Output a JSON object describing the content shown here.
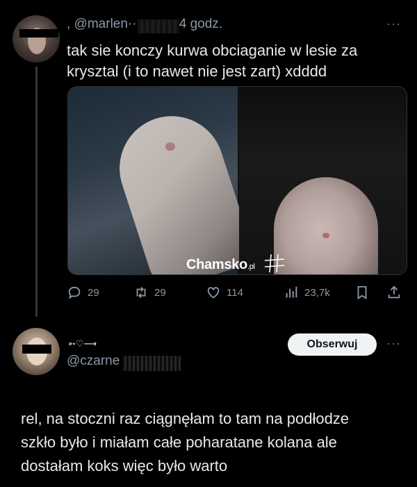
{
  "post1": {
    "handle": ", @marlen········· · 4 godz.",
    "more": "···",
    "text_line1": "tak sie konczy kurwa obciaganie w lesie za",
    "text_line2": "krysztal (i to nawet nie jest zart) xdddd",
    "media": [
      "photo-arm",
      "photo-knee"
    ],
    "actions": {
      "replies": "29",
      "retweets": "29",
      "likes": "114",
      "views": "23,7k"
    }
  },
  "watermark": {
    "brand": "Chamsko",
    "tld": ".pl"
  },
  "post2": {
    "emoji_line": "➳♡⟶",
    "handle": "@czarne",
    "follow_label": "Obserwuj",
    "more": "···",
    "text_line1": "rel, na stoczni raz ciągnęłam to tam na podłodze",
    "text_line2": "szkło było i miałam całe poharatane kolana ale",
    "text_line3": "dostałam koks więc było warto"
  },
  "colors": {
    "background": "#000000",
    "text": "#e7e9ea",
    "muted": "#8b98a5",
    "follow_bg": "#eff3f4"
  }
}
